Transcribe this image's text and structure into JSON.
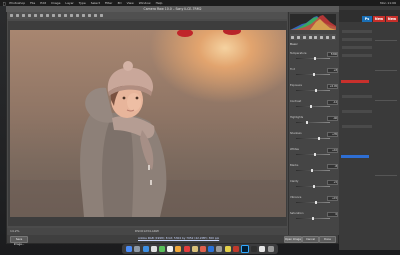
{
  "menubar": {
    "apple": "",
    "items": [
      "Photoshop",
      "File",
      "Edit",
      "Image",
      "Layer",
      "Type",
      "Select",
      "Filter",
      "3D",
      "View",
      "Window",
      "Help"
    ],
    "right": "Mon 11:06"
  },
  "dialog": {
    "title": "Camera Raw 10.0  –  Sony ILCE-7RM2"
  },
  "preview": {
    "zoom": "14.2%",
    "file_name": "DSC01234.ARW",
    "workflow_link": "Adobe RGB (1998); 8 bit; 5304 by 7952 (42.2MP); 300 ppi"
  },
  "buttons": {
    "save": "Save Image...",
    "open": "Open Image",
    "cancel": "Cancel",
    "done": "Done"
  },
  "basic_panel": {
    "title": "Basic",
    "rows": [
      {
        "label": "Temperature",
        "value": "5300",
        "pos": 0.55
      },
      {
        "label": "Tint",
        "value": "+8",
        "pos": 0.52
      },
      {
        "label": "Exposure",
        "value": "+0.45",
        "pos": 0.58
      },
      {
        "label": "Contrast",
        "value": "-12",
        "pos": 0.45
      },
      {
        "label": "Highlights",
        "value": "-40",
        "pos": 0.32
      },
      {
        "label": "Shadows",
        "value": "+35",
        "pos": 0.68
      },
      {
        "label": "Whites",
        "value": "+10",
        "pos": 0.55
      },
      {
        "label": "Blacks",
        "value": "-8",
        "pos": 0.46
      },
      {
        "label": "Clarity",
        "value": "+5",
        "pos": 0.53
      },
      {
        "label": "Vibrance",
        "value": "+15",
        "pos": 0.58
      },
      {
        "label": "Saturation",
        "value": "0",
        "pos": 0.5
      }
    ]
  },
  "ps_badges": {
    "a": "Ps",
    "b": "New",
    "c": "New"
  },
  "colors": {
    "accent_red": "#c8302c",
    "accent_blue": "#2e6ed3"
  }
}
